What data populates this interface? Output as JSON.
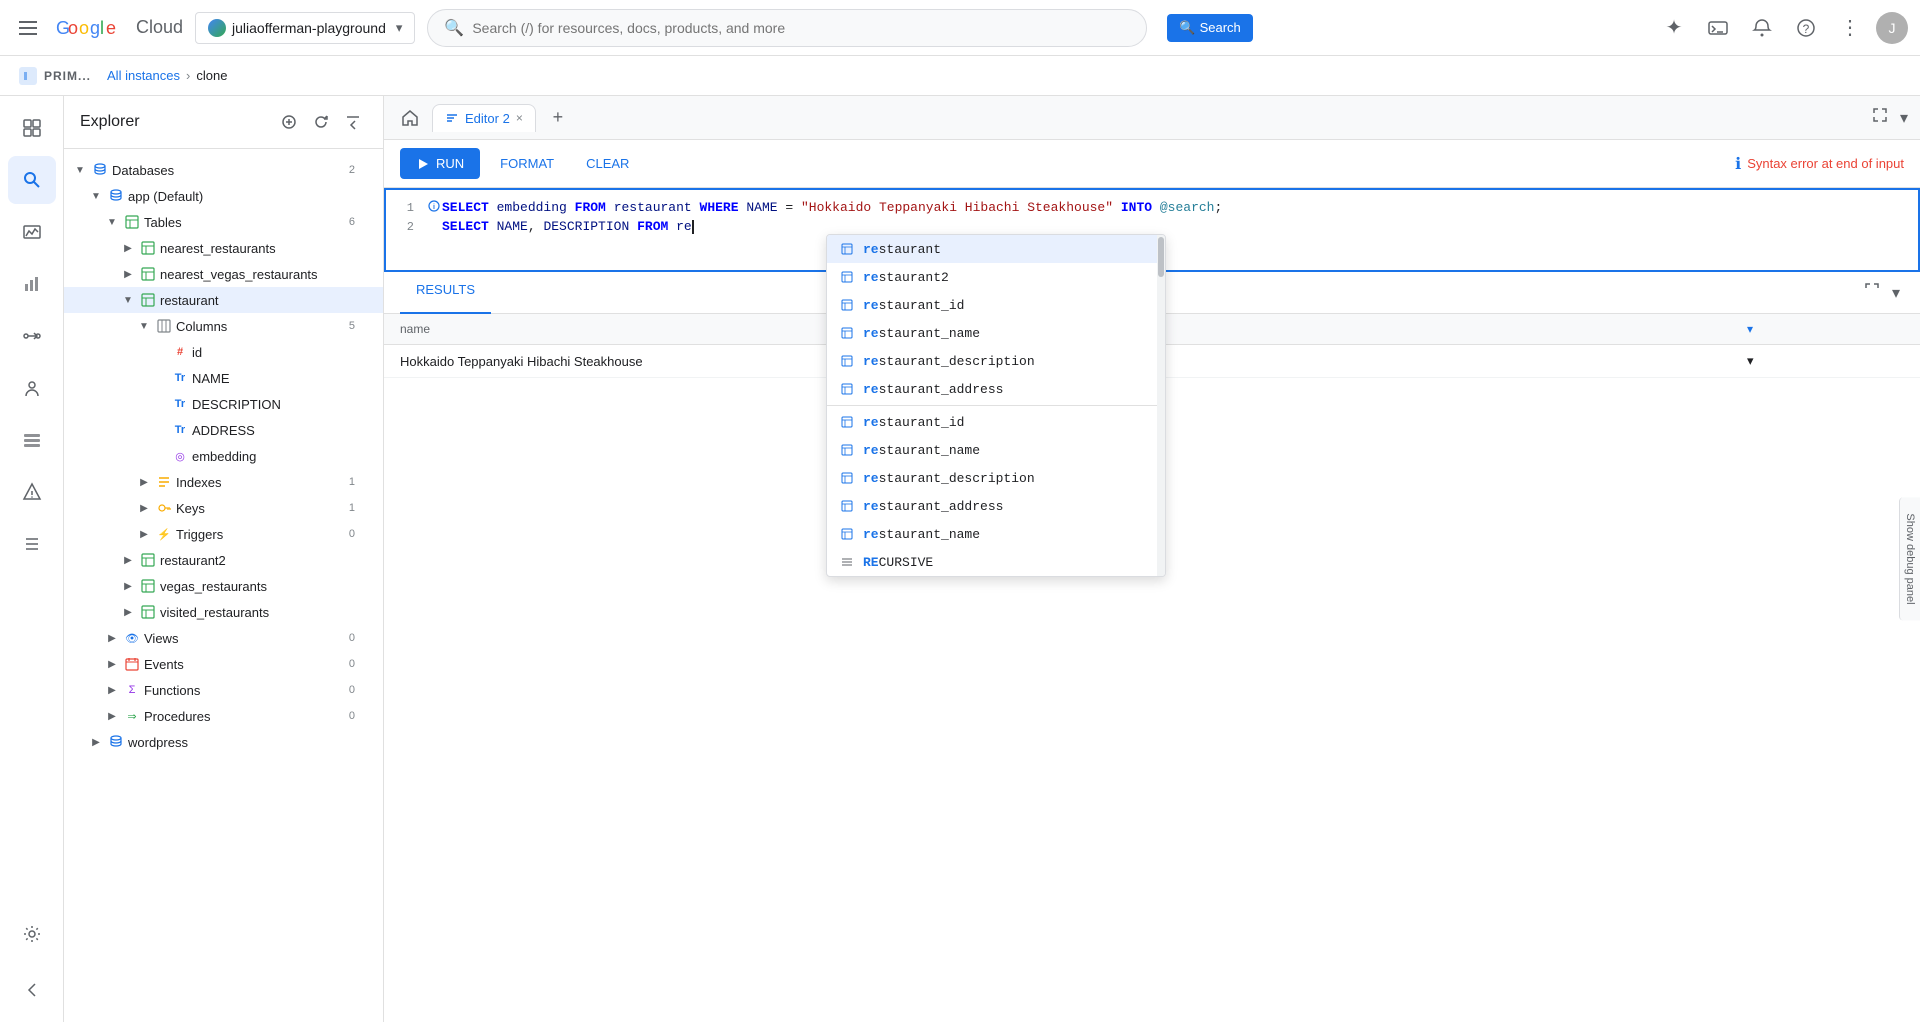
{
  "topbar": {
    "menu_icon": "☰",
    "logo_google": "Google",
    "logo_cloud": " Cloud",
    "project_name": "juliaofferman-playground",
    "search_placeholder": "Search (/) for resources, docs, products, and more",
    "search_label": "Search",
    "icons": {
      "gemini": "✦",
      "notifications": "🔔",
      "help": "?",
      "more": "⋮"
    }
  },
  "breadcrumb": {
    "all_instances": "All instances",
    "sep": "›",
    "current": "clone"
  },
  "sidebar": {
    "title": "Explorer",
    "databases_label": "Databases",
    "databases_count": "2",
    "app_default": "app (Default)",
    "tables_label": "Tables",
    "tables_count": "6",
    "tables": [
      {
        "name": "nearest_restaurants",
        "expanded": false
      },
      {
        "name": "nearest_vegas_restaurants",
        "expanded": false
      },
      {
        "name": "restaurant",
        "expanded": true,
        "selected": true
      },
      {
        "name": "restaurant2",
        "expanded": false
      },
      {
        "name": "vegas_restaurants",
        "expanded": false
      },
      {
        "name": "visited_restaurants",
        "expanded": false
      }
    ],
    "columns_label": "Columns",
    "columns_count": "5",
    "columns": [
      {
        "name": "id",
        "type": "num"
      },
      {
        "name": "NAME",
        "type": "text"
      },
      {
        "name": "DESCRIPTION",
        "type": "text"
      },
      {
        "name": "ADDRESS",
        "type": "text"
      },
      {
        "name": "embedding",
        "type": "embed"
      }
    ],
    "indexes_label": "Indexes",
    "indexes_count": "1",
    "keys_label": "Keys",
    "keys_count": "1",
    "triggers_label": "Triggers",
    "triggers_count": "0",
    "views_label": "Views",
    "views_count": "0",
    "events_label": "Events",
    "events_count": "0",
    "functions_label": "Functions",
    "functions_count": "0",
    "procedures_label": "Procedures",
    "procedures_count": "0",
    "wordpress_label": "wordpress"
  },
  "tabs": {
    "home_icon": "🏠",
    "editor_tab": "Editor 2",
    "add_icon": "+",
    "close_icon": "×"
  },
  "toolbar": {
    "run_label": "RUN",
    "format_label": "FORMAT",
    "clear_label": "CLEAR",
    "error_msg": "Syntax error at end of input"
  },
  "sql": {
    "line1": "SELECT embedding FROM restaurant WHERE NAME = \"Hokkaido Teppanyaki Hibachi Steakhouse\" INTO @search;",
    "line2_prefix": "SELECT NAME, DESCRIPTION FROM re",
    "cursor": ""
  },
  "autocomplete": {
    "items": [
      {
        "icon": "⬡",
        "match": "re",
        "rest": "staurant",
        "type": "table"
      },
      {
        "icon": "⬡",
        "match": "re",
        "rest": "staurant2",
        "type": "table"
      },
      {
        "icon": "⬡",
        "match": "re",
        "rest": "staurant_id",
        "type": "col"
      },
      {
        "icon": "⬡",
        "match": "re",
        "rest": "staurant_name",
        "type": "col"
      },
      {
        "icon": "⬡",
        "match": "re",
        "rest": "staurant_description",
        "type": "col"
      },
      {
        "icon": "⬡",
        "match": "re",
        "rest": "staurant_address",
        "type": "col"
      },
      {
        "icon": "⬡",
        "match": "re",
        "rest": "staurant_id",
        "type": "col2"
      },
      {
        "icon": "⬡",
        "match": "re",
        "rest": "staurant_name",
        "type": "col2"
      },
      {
        "icon": "⬡",
        "match": "re",
        "rest": "staurant_description",
        "type": "col2"
      },
      {
        "icon": "⬡",
        "match": "re",
        "rest": "staurant_address",
        "type": "col2"
      },
      {
        "icon": "⬡",
        "match": "re",
        "rest": "staurant_name",
        "type": "col3"
      },
      {
        "icon": "≡",
        "match": "RE",
        "rest": "CURSIVE",
        "type": "keyword"
      }
    ]
  },
  "results": {
    "tab_label": "RESULTS",
    "column_name": "name",
    "row1": "Hokkaido Teppanyaki Hibachi Steakhouse"
  },
  "debug_panel": {
    "label": "Show debug panel"
  },
  "nav_items": [
    {
      "icon": "⊞",
      "name": "overview"
    },
    {
      "icon": "🔍",
      "name": "search",
      "active": true
    },
    {
      "icon": "≡",
      "name": "list"
    },
    {
      "icon": "📊",
      "name": "chart"
    },
    {
      "icon": "➡",
      "name": "dataflow"
    },
    {
      "icon": "👥",
      "name": "iam"
    },
    {
      "icon": "📋",
      "name": "operations"
    },
    {
      "icon": "🔔",
      "name": "alerts"
    },
    {
      "icon": "📝",
      "name": "logs"
    }
  ]
}
